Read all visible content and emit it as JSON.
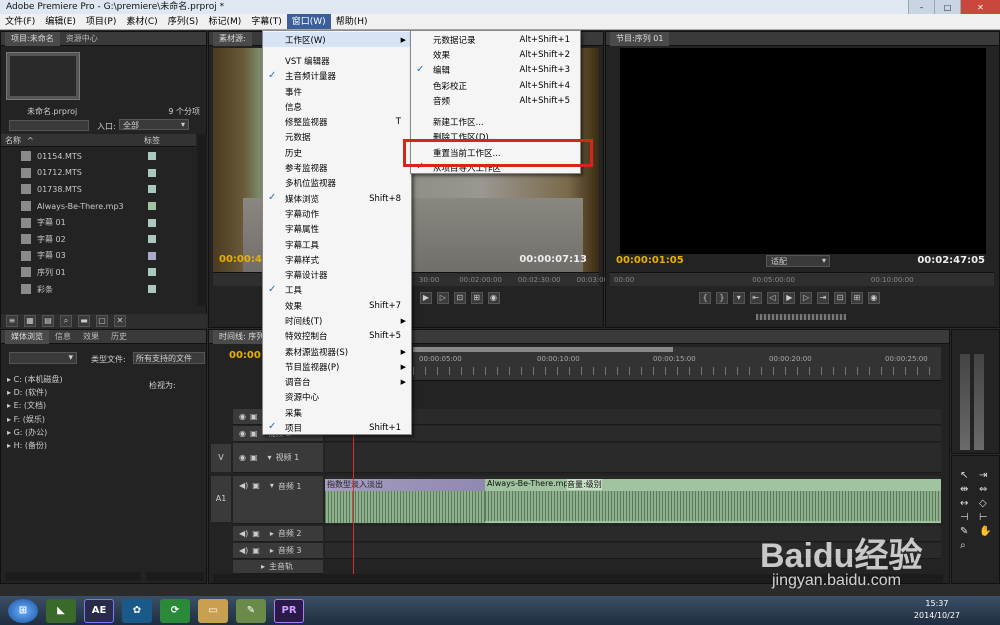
{
  "window": {
    "title": "Adobe Premiere Pro - G:\\premiere\\未命名.prproj *"
  },
  "menubar": {
    "items": [
      "文件(F)",
      "编辑(E)",
      "项目(P)",
      "素材(C)",
      "序列(S)",
      "标记(M)",
      "字幕(T)",
      "窗口(W)",
      "帮助(H)"
    ],
    "active_index": 7
  },
  "project_panel": {
    "tabs": [
      "项目:未命名",
      "资源中心"
    ],
    "file_name": "未命名.prproj",
    "count": "9 个分项",
    "in_label": "入口:",
    "in_value": "全部",
    "col_name": "名称",
    "col_label": "标签",
    "items": [
      {
        "name": "01154.MTS",
        "color": "#a9c9c0"
      },
      {
        "name": "01712.MTS",
        "color": "#a9c9c0"
      },
      {
        "name": "01738.MTS",
        "color": "#a9c9c0"
      },
      {
        "name": "Always-Be-There.mp3",
        "color": "#9fc49f"
      },
      {
        "name": "字幕 01",
        "color": "#a9c9c0"
      },
      {
        "name": "字幕 02",
        "color": "#a9c9c0"
      },
      {
        "name": "字幕 03",
        "color": "#a9a9c9"
      },
      {
        "name": "序列 01",
        "color": "#a9c9c0"
      },
      {
        "name": "彩条",
        "color": "#a9c9c0"
      }
    ]
  },
  "source_monitor": {
    "tab": "素材源:",
    "timecode_left": "00:00:48",
    "timecode_right": "00:00:07:13",
    "ruler": [
      "30:00",
      "00:02:00:00",
      "00:02:30:00",
      "00:03:00"
    ]
  },
  "program_monitor": {
    "tab": "节目:序列 01",
    "timecode_left": "00:00:01:05",
    "fit": "适配",
    "timecode_right": "00:02:47:05",
    "ruler": [
      "00:00",
      "00:05:00:00",
      "00:10:00:00"
    ]
  },
  "media_browser": {
    "tabs": [
      "媒体浏览",
      "信息",
      "效果",
      "历史"
    ],
    "file_type_label": "类型文件:",
    "file_type_value": "所有支持的文件",
    "view_as_label": "检视为:",
    "drives": [
      "C: (本机磁盘)",
      "D: (软件)",
      "E: (文档)",
      "F: (娱乐)",
      "G: (办公)",
      "H: (备份)"
    ]
  },
  "timeline": {
    "tab": "时间线: 序列",
    "timecode": "00:00",
    "ruler": [
      "00:00:05:00",
      "00:00:10:00",
      "00:00:15:00",
      "00:00:20:00",
      "00:00:25:00"
    ],
    "video_label": "V",
    "audio_label": "A1",
    "tracks": {
      "video1": "视频 1",
      "video2": "视频 2",
      "audio1": "音频 1",
      "audio2": "音频 2",
      "audio3": "音频 3",
      "master": "主音轨"
    },
    "clip_transition": "指数型淡入淡出",
    "clip_audio": "Always-Be-There.mp3",
    "clip_volume": "音量:级别"
  },
  "window_menu": {
    "items": [
      {
        "label": "工作区(W)",
        "check": false,
        "shortcut": "",
        "submenu": true,
        "highlight": true
      },
      {
        "sep": true
      },
      {
        "label": "VST 编辑器",
        "check": false,
        "shortcut": "",
        "submenu": false
      },
      {
        "label": "主音频计量器",
        "check": true,
        "shortcut": "",
        "submenu": false
      },
      {
        "label": "事件",
        "check": false,
        "shortcut": "",
        "submenu": false
      },
      {
        "label": "信息",
        "check": false,
        "shortcut": "",
        "submenu": false
      },
      {
        "label": "修整监视器",
        "check": false,
        "shortcut": "T",
        "submenu": false
      },
      {
        "label": "元数据",
        "check": false,
        "shortcut": "",
        "submenu": false
      },
      {
        "label": "历史",
        "check": false,
        "shortcut": "",
        "submenu": false
      },
      {
        "label": "参考监视器",
        "check": false,
        "shortcut": "",
        "submenu": false
      },
      {
        "label": "多机位监视器",
        "check": false,
        "shortcut": "",
        "submenu": false
      },
      {
        "label": "媒体浏览",
        "check": true,
        "shortcut": "Shift+8",
        "submenu": false
      },
      {
        "label": "字幕动作",
        "check": false,
        "shortcut": "",
        "submenu": false
      },
      {
        "label": "字幕属性",
        "check": false,
        "shortcut": "",
        "submenu": false
      },
      {
        "label": "字幕工具",
        "check": false,
        "shortcut": "",
        "submenu": false
      },
      {
        "label": "字幕样式",
        "check": false,
        "shortcut": "",
        "submenu": false
      },
      {
        "label": "字幕设计器",
        "check": false,
        "shortcut": "",
        "submenu": false
      },
      {
        "label": "工具",
        "check": true,
        "shortcut": "",
        "submenu": false
      },
      {
        "label": "效果",
        "check": false,
        "shortcut": "Shift+7",
        "submenu": false
      },
      {
        "label": "时间线(T)",
        "check": false,
        "shortcut": "",
        "submenu": true
      },
      {
        "label": "特效控制台",
        "check": false,
        "shortcut": "Shift+5",
        "submenu": false
      },
      {
        "label": "素材源监视器(S)",
        "check": false,
        "shortcut": "",
        "submenu": true
      },
      {
        "label": "节目监视器(P)",
        "check": false,
        "shortcut": "",
        "submenu": true
      },
      {
        "label": "调音台",
        "check": false,
        "shortcut": "",
        "submenu": true
      },
      {
        "label": "资源中心",
        "check": false,
        "shortcut": "",
        "submenu": false
      },
      {
        "label": "采集",
        "check": false,
        "shortcut": "",
        "submenu": false
      },
      {
        "label": "项目",
        "check": true,
        "shortcut": "Shift+1",
        "submenu": false
      }
    ]
  },
  "workspace_menu": {
    "items": [
      {
        "label": "元数据记录",
        "check": false,
        "shortcut": "Alt+Shift+1"
      },
      {
        "label": "效果",
        "check": false,
        "shortcut": "Alt+Shift+2"
      },
      {
        "label": "编辑",
        "check": true,
        "shortcut": "Alt+Shift+3"
      },
      {
        "label": "色彩校正",
        "check": false,
        "shortcut": "Alt+Shift+4"
      },
      {
        "label": "音频",
        "check": false,
        "shortcut": "Alt+Shift+5"
      },
      {
        "sep": true
      },
      {
        "label": "新建工作区...",
        "check": false,
        "shortcut": ""
      },
      {
        "label": "删除工作区(D)...",
        "check": false,
        "shortcut": ""
      },
      {
        "label": "重置当前工作区...",
        "check": false,
        "shortcut": "",
        "boxed": true
      },
      {
        "label": "从项目导入工作区",
        "check": true,
        "shortcut": ""
      }
    ],
    "highlight_color": "#d9241c"
  },
  "taskbar": {
    "time": "15:37",
    "date": "2014/10/27",
    "apps": [
      "AE",
      "PR"
    ]
  },
  "watermark": {
    "brand": "Baidu经验",
    "url": "jingyan.baidu.com"
  }
}
